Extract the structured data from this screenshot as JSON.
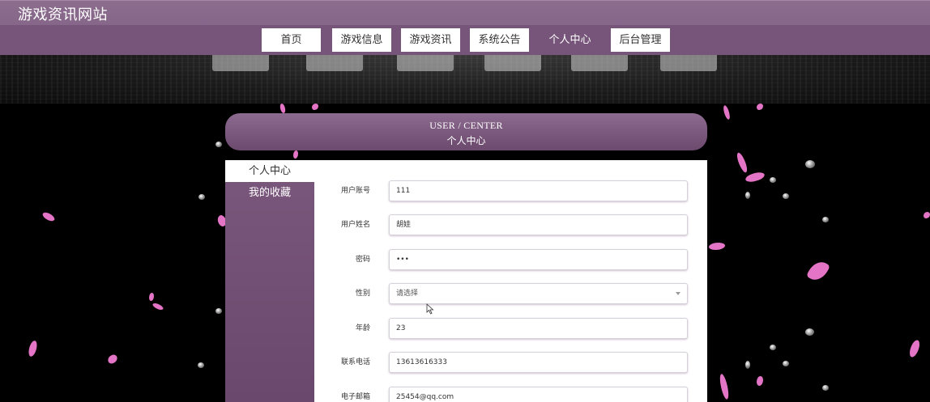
{
  "site": {
    "title": "游戏资讯网站"
  },
  "nav": {
    "items": [
      {
        "label": "首页"
      },
      {
        "label": "游戏信息"
      },
      {
        "label": "游戏资讯"
      },
      {
        "label": "系统公告"
      },
      {
        "label": "个人中心"
      },
      {
        "label": "后台管理"
      }
    ],
    "active_index": 4
  },
  "section": {
    "title_en": "USER / CENTER",
    "title_cn": "个人中心"
  },
  "sidebar": {
    "items": [
      {
        "label": "个人中心"
      },
      {
        "label": "我的收藏"
      }
    ],
    "active_index": 0
  },
  "form": {
    "fields": [
      {
        "label": "用户账号",
        "value": "111"
      },
      {
        "label": "用户姓名",
        "value": "胡娃"
      },
      {
        "label": "密码",
        "value": "•••"
      },
      {
        "label": "性别",
        "value": "请选择",
        "type": "select"
      },
      {
        "label": "年龄",
        "value": "23"
      },
      {
        "label": "联系电话",
        "value": "13613616333"
      },
      {
        "label": "电子邮箱",
        "value": "25454@qq.com"
      }
    ]
  },
  "colors": {
    "topbar": "#8d6d8e",
    "navbar": "#775479",
    "accent": "#7a577c",
    "petal": "#f07ad0"
  }
}
